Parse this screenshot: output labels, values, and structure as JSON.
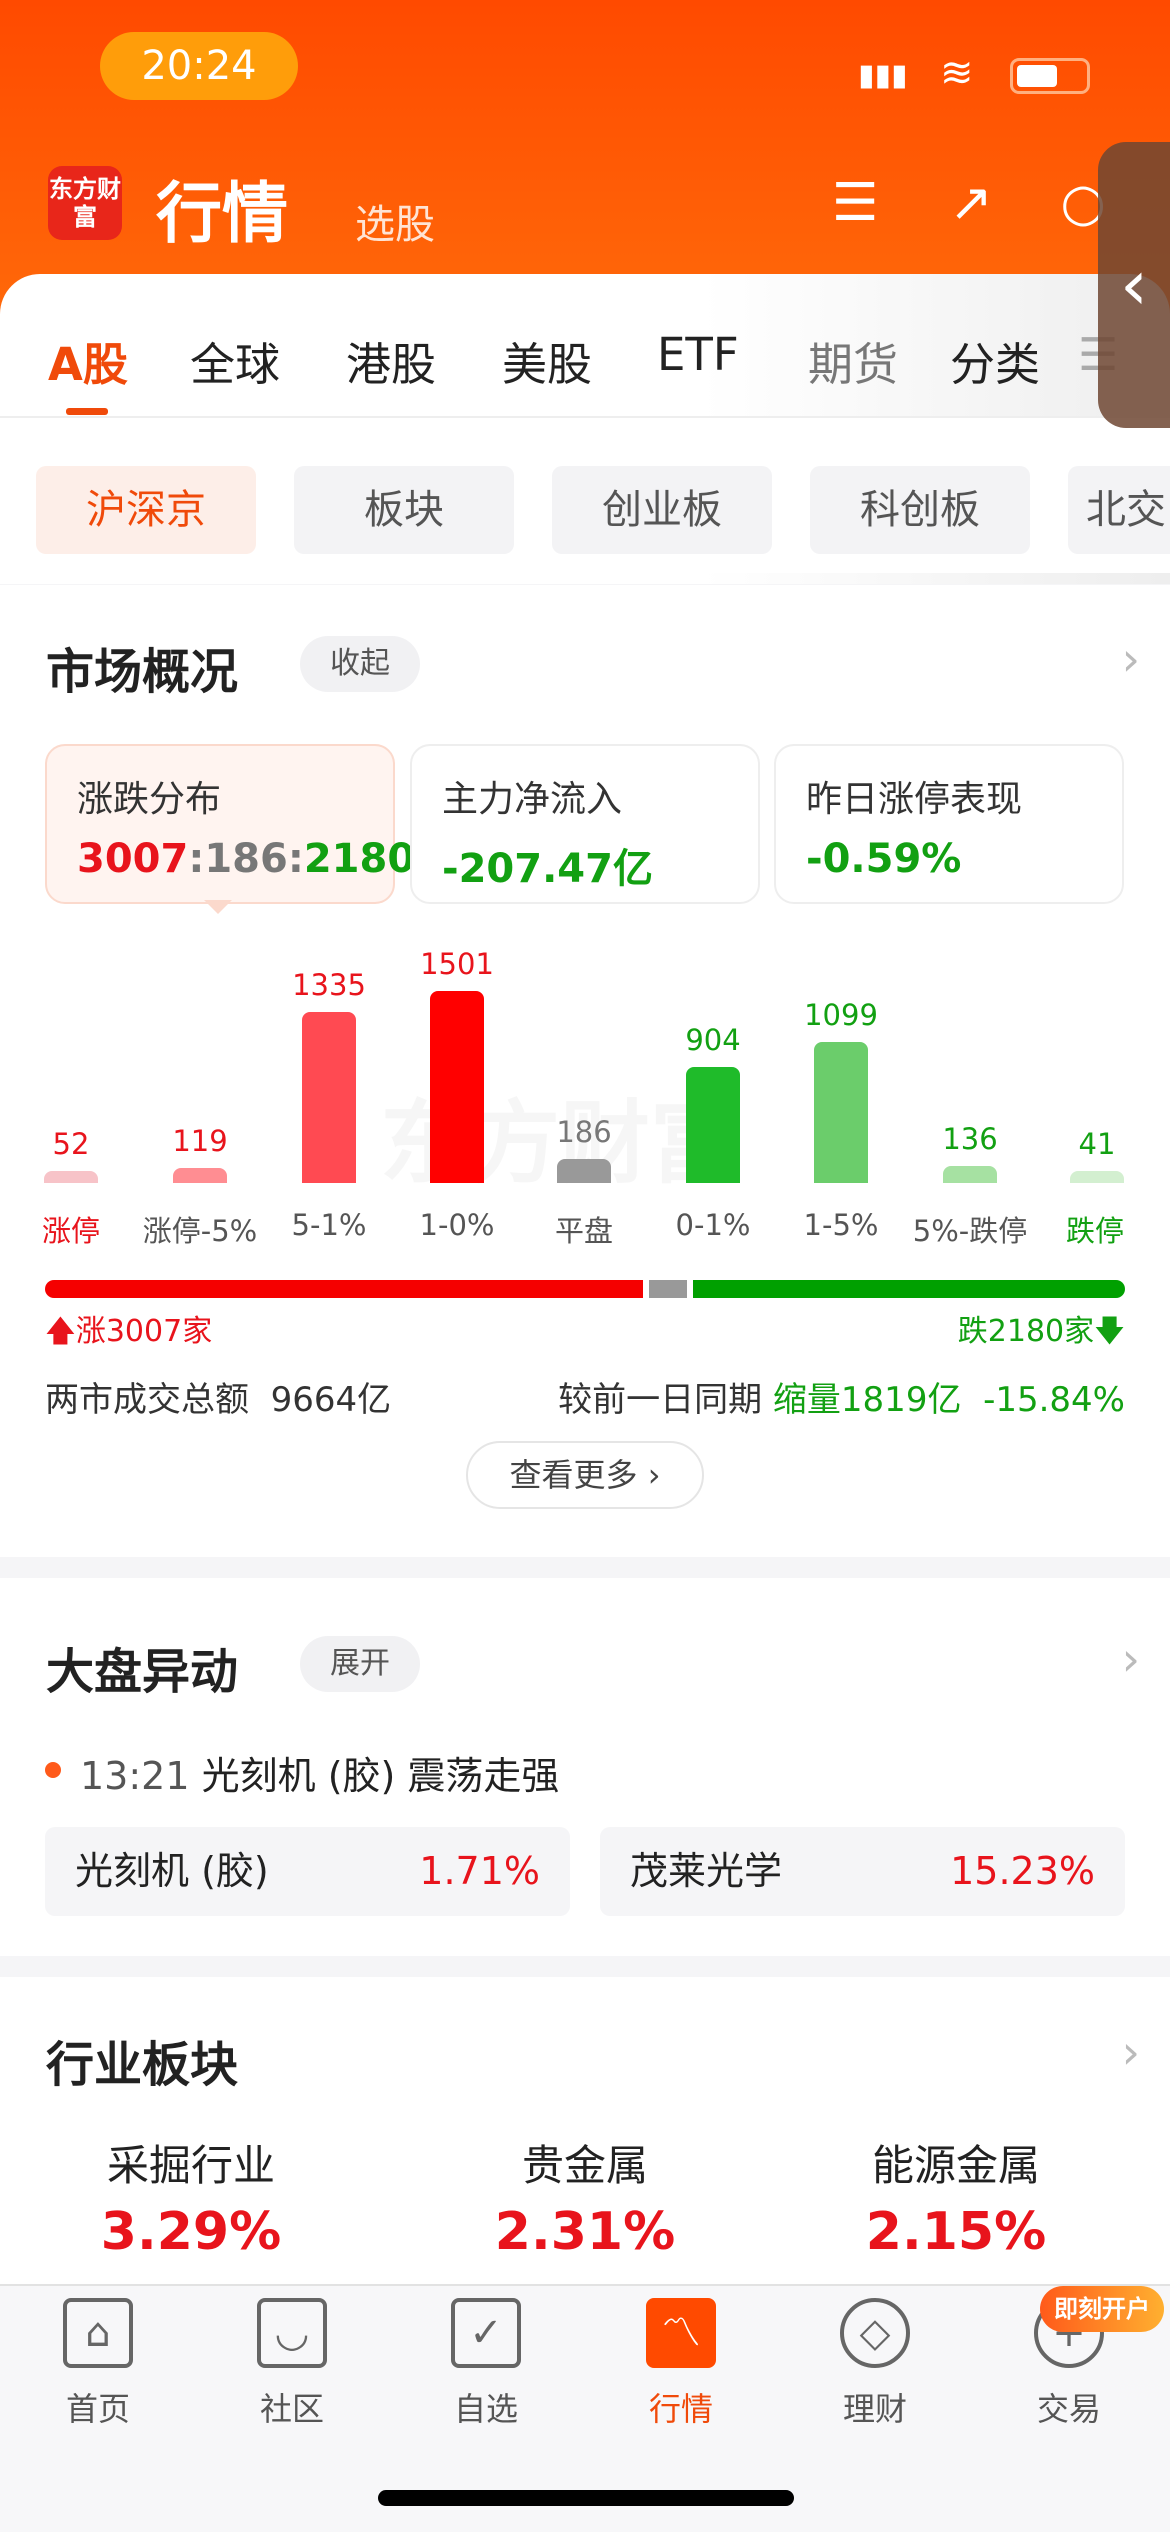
{
  "status_bar": {
    "time": "20:24"
  },
  "header": {
    "logo_text": "东方财富",
    "title": "行情",
    "subtitle": "选股"
  },
  "tabs": [
    {
      "label": "A股",
      "active": true
    },
    {
      "label": "全球"
    },
    {
      "label": "港股"
    },
    {
      "label": "美股"
    },
    {
      "label": "ETF"
    },
    {
      "label": "期货"
    },
    {
      "label": "分类"
    }
  ],
  "subtabs": [
    {
      "label": "沪深京",
      "active": true
    },
    {
      "label": "板块"
    },
    {
      "label": "创业板"
    },
    {
      "label": "科创板"
    },
    {
      "label": "北交"
    }
  ],
  "market": {
    "title": "市场概况",
    "toggle": "收起",
    "cards": [
      {
        "label": "涨跌分布",
        "up": "3007",
        "flat": "186",
        "down": "2180",
        "sep": ":"
      },
      {
        "label": "主力净流入",
        "value": "-207.47亿"
      },
      {
        "label": "昨日涨停表现",
        "value": "-0.59%"
      }
    ],
    "watermark": "东方财富",
    "up_text": "涨3007家",
    "down_text": "跌2180家",
    "turnover_label": "两市成交总额",
    "turnover_value": "9664亿",
    "compare_label": "较前一日同期",
    "compare_value": "缩量1819亿",
    "compare_pct": "-15.84%",
    "more": "查看更多"
  },
  "chart_data": {
    "type": "bar",
    "categories": [
      "涨停",
      "涨停-5%",
      "5-1%",
      "1-0%",
      "平盘",
      "0-1%",
      "1-5%",
      "5%-跌停",
      "跌停"
    ],
    "values": [
      52,
      119,
      1335,
      1501,
      186,
      904,
      1099,
      136,
      41
    ],
    "colors": [
      "#f7c3c8",
      "#ff8d92",
      "#ff4a52",
      "#ff0000",
      "#999999",
      "#1fbb2a",
      "#6bcd6b",
      "#a6e1a2",
      "#d3efd0"
    ],
    "label_colors": [
      "#e8141c",
      "#e8141c",
      "#e8141c",
      "#e8141c",
      "#777777",
      "#12a012",
      "#12a012",
      "#12a012",
      "#12a012"
    ],
    "progress": {
      "up": 3007,
      "flat": 186,
      "down": 2180
    }
  },
  "movement": {
    "title": "大盘异动",
    "toggle": "展开",
    "time": "13:21",
    "headline": "光刻机 (胶) 震荡走强",
    "items": [
      {
        "name": "光刻机 (胶)",
        "pct": "1.71%"
      },
      {
        "name": "茂莱光学",
        "pct": "15.23%"
      }
    ]
  },
  "industry": {
    "title": "行业板块",
    "items": [
      {
        "name": "采掘行业",
        "pct": "3.29%"
      },
      {
        "name": "贵金属",
        "pct": "2.31%"
      },
      {
        "name": "能源金属",
        "pct": "2.15%"
      }
    ]
  },
  "bottom_nav": [
    {
      "label": "首页",
      "icon": "⌂"
    },
    {
      "label": "社区",
      "icon": "◡"
    },
    {
      "label": "自选",
      "icon": "✓"
    },
    {
      "label": "行情",
      "icon": "〽",
      "active": true
    },
    {
      "label": "理财",
      "icon": "◇"
    },
    {
      "label": "交易",
      "icon": "+"
    }
  ],
  "badge": "即刻开户",
  "colors": {
    "brand": "#ff4a00",
    "up": "#e8141c",
    "down": "#12a012"
  }
}
